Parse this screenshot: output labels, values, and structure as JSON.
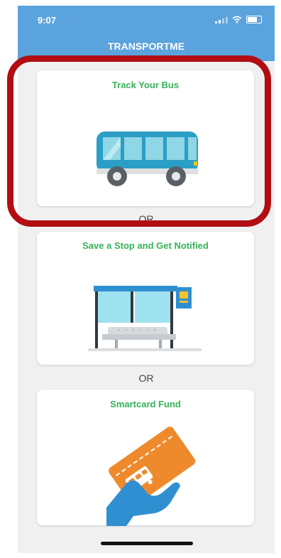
{
  "status_bar": {
    "time": "9:07"
  },
  "header": {
    "title": "TRANSPORTME"
  },
  "cards": [
    {
      "title": "Track Your Bus",
      "illustration": "bus-icon"
    },
    {
      "title": "Save a Stop and Get Notified",
      "illustration": "bus-stop-icon"
    },
    {
      "title": "Smartcard Fund",
      "illustration": "smartcard-icon"
    }
  ],
  "separators": [
    "OR",
    "OR"
  ],
  "colors": {
    "header_bg": "#5ba3dc",
    "card_title": "#35b35a",
    "highlight": "#b10d12",
    "bus": "#2a9ec6",
    "card": "#ef8a2c"
  }
}
